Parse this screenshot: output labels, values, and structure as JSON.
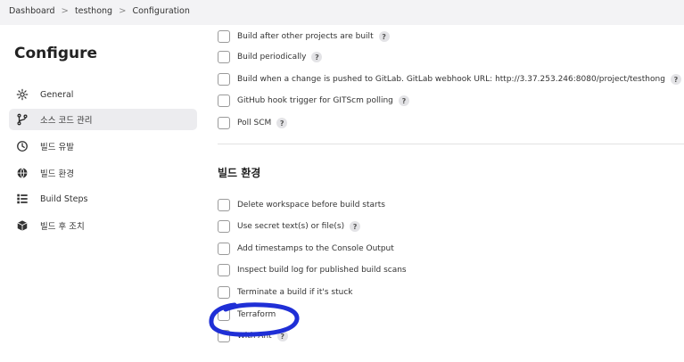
{
  "breadcrumb": [
    "Dashboard",
    "testhong",
    "Configuration"
  ],
  "sidebar": {
    "title": "Configure",
    "items": [
      {
        "label": "General",
        "icon": "gear-icon"
      },
      {
        "label": "소스 코드 관리",
        "icon": "branch-icon"
      },
      {
        "label": "빌드 유발",
        "icon": "clock-icon"
      },
      {
        "label": "빌드 환경",
        "icon": "globe-icon"
      },
      {
        "label": "Build Steps",
        "icon": "list-icon"
      },
      {
        "label": "빌드 후 조치",
        "icon": "package-icon"
      }
    ],
    "active_index": 1
  },
  "triggers": [
    {
      "label": "Build after other projects are built",
      "checked": false,
      "help": "?"
    },
    {
      "label": "Build periodically",
      "checked": false,
      "help": "?"
    },
    {
      "label": "Build when a change is pushed to GitLab. GitLab webhook URL: http://3.37.253.246:8080/project/testhong",
      "checked": false,
      "help": "?"
    },
    {
      "label": "GitHub hook trigger for GITScm polling",
      "checked": false,
      "help": "?"
    },
    {
      "label": "Poll SCM",
      "checked": false,
      "help": "?"
    }
  ],
  "build_env": {
    "title": "빌드 환경",
    "options": [
      {
        "label": "Delete workspace before build starts",
        "checked": false
      },
      {
        "label": "Use secret text(s) or file(s)",
        "checked": false,
        "help": "?"
      },
      {
        "label": "Add timestamps to the Console Output",
        "checked": false
      },
      {
        "label": "Inspect build log for published build scans",
        "checked": false
      },
      {
        "label": "Terminate a build if it's stuck",
        "checked": false
      },
      {
        "label": "Terraform",
        "checked": false
      },
      {
        "label": "With Ant",
        "checked": false,
        "help": "?"
      }
    ]
  },
  "colors": {
    "annotation": "#1f2fd6",
    "active_bg": "#ececef",
    "topbar_bg": "#f3f3f5"
  }
}
